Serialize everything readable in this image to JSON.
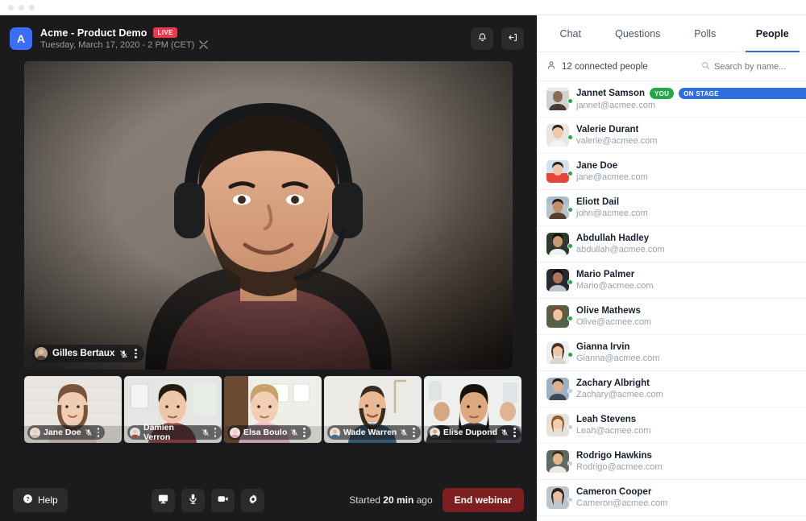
{
  "window": {
    "dots": 3
  },
  "stage": {
    "brand_letter": "A",
    "title": "Acme - Product Demo",
    "live_badge": "LIVE",
    "subtitle": "Tuesday, March 17, 2020 - 2 PM (CET)",
    "expand_icon": "expand-icon",
    "header_buttons": [
      {
        "name": "notifications-button",
        "icon": "bell-icon"
      },
      {
        "name": "collapse-panel-button",
        "icon": "arrow-left-into-bracket-icon"
      }
    ],
    "main_speaker": {
      "name": "Gilles Bertaux",
      "mic_icon": "mic-muted-icon",
      "menu_icon": "kebab-menu-icon"
    },
    "thumbnails": [
      {
        "name": "Jane Doe",
        "mic_icon": "mic-muted-icon"
      },
      {
        "name": "Damien Verron",
        "mic_icon": "mic-muted-icon"
      },
      {
        "name": "Elsa Boulo",
        "mic_icon": "mic-muted-icon"
      },
      {
        "name": "Wade Warren",
        "mic_icon": "mic-muted-icon"
      },
      {
        "name": "Elise Dupond",
        "mic_icon": "mic-muted-icon"
      }
    ]
  },
  "toolbar": {
    "help_label": "Help",
    "help_icon": "question-circle-icon",
    "controls": [
      {
        "name": "share-screen-button",
        "icon": "monitor-icon"
      },
      {
        "name": "microphone-button",
        "icon": "microphone-icon"
      },
      {
        "name": "camera-button",
        "icon": "video-camera-icon"
      },
      {
        "name": "settings-button",
        "icon": "gear-icon"
      }
    ],
    "started_prefix": "Started ",
    "started_value": "20 min",
    "started_suffix": " ago",
    "end_label": "End webinar"
  },
  "panel": {
    "tabs": [
      {
        "label": "Chat",
        "active": false
      },
      {
        "label": "Questions",
        "active": false
      },
      {
        "label": "Polls",
        "active": false
      },
      {
        "label": "People",
        "active": true
      }
    ],
    "count_label": "12 connected people",
    "count_icon": "person-icon",
    "search_icon": "search-icon",
    "search_placeholder": "Search by name...",
    "people": [
      {
        "name": "Jannet Samson",
        "email": "jannet@acmee.com",
        "online": true,
        "badges": [
          "YOU",
          "ON STAGE"
        ]
      },
      {
        "name": "Valerie Durant",
        "email": "valerie@acmee.com",
        "online": true,
        "badges": []
      },
      {
        "name": "Jane Doe",
        "email": "jane@acmee.com",
        "online": true,
        "badges": []
      },
      {
        "name": "Eliott Dail",
        "email": "john@acmee.com",
        "online": true,
        "badges": []
      },
      {
        "name": "Abdullah Hadley",
        "email": "abdullah@acmee.com",
        "online": true,
        "badges": []
      },
      {
        "name": "Mario Palmer",
        "email": "Mario@acmee.com",
        "online": true,
        "badges": []
      },
      {
        "name": "Olive Mathews",
        "email": "Olive@acmee.com",
        "online": true,
        "badges": []
      },
      {
        "name": "Gianna Irvin",
        "email": "Gianna@acmee.com",
        "online": true,
        "badges": []
      },
      {
        "name": "Zachary Albright",
        "email": "Zachary@acmee.com",
        "online": false,
        "badges": []
      },
      {
        "name": "Leah Stevens",
        "email": "Leah@acmee.com",
        "online": false,
        "badges": []
      },
      {
        "name": "Rodrigo Hawkins",
        "email": "Rodrigo@acmee.com",
        "online": false,
        "badges": []
      },
      {
        "name": "Cameron Cooper",
        "email": "Cameron@acmee.com",
        "online": false,
        "badges": []
      }
    ]
  },
  "colors": {
    "accent_blue": "#2f6fe0",
    "live_red": "#f0374b",
    "online_green": "#21a84a",
    "end_red": "#7d1f1f",
    "stage_bg": "#1b1b1d"
  }
}
